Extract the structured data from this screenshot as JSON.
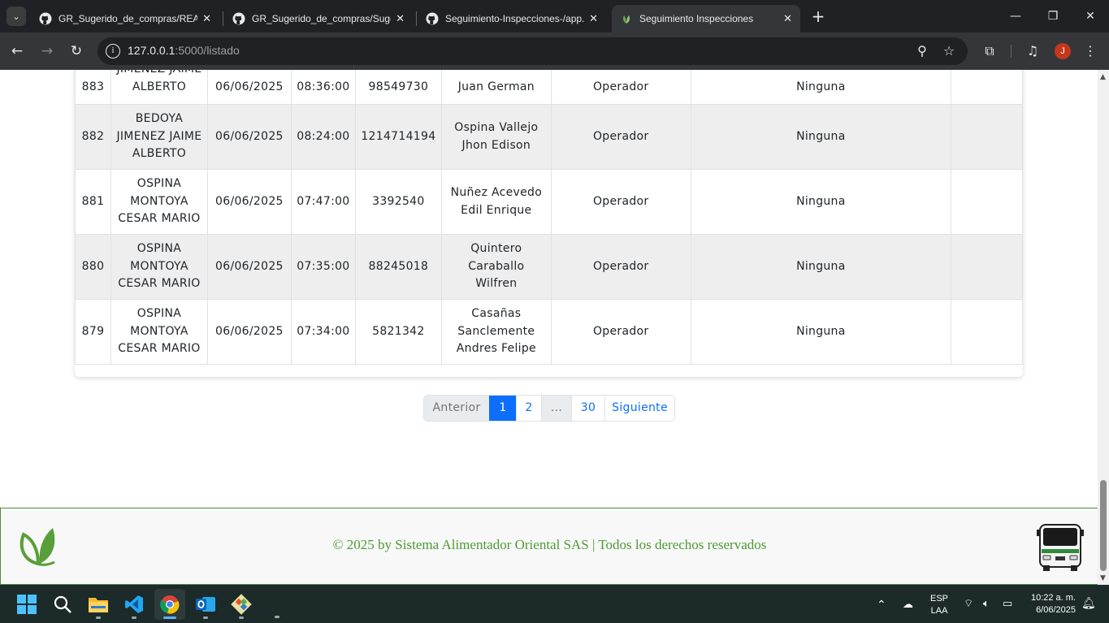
{
  "browser": {
    "tabs": [
      {
        "title": "GR_Sugerido_de_compras/README",
        "icon": "github-icon"
      },
      {
        "title": "GR_Sugerido_de_compras/Sugerido",
        "icon": "github-icon"
      },
      {
        "title": "Seguimiento-Inspecciones-/app.py",
        "icon": "github-icon"
      },
      {
        "title": "Seguimiento Inspecciones",
        "icon": "leaf-icon",
        "active": true
      }
    ],
    "url_host": "127.0.0.1",
    "url_path": ":5000/listado",
    "avatar_letter": "J"
  },
  "table": {
    "rows": [
      {
        "id": "883",
        "inspector": "JIMENEZ JAIME ALBERTO",
        "fecha": "06/06/2025",
        "hora": "08:36:00",
        "cedula": "98549730",
        "nombre": "Juan German",
        "cargo": "Operador",
        "novedad": "Ninguna",
        "extra": ""
      },
      {
        "id": "882",
        "inspector": "BEDOYA JIMENEZ JAIME ALBERTO",
        "fecha": "06/06/2025",
        "hora": "08:24:00",
        "cedula": "1214714194",
        "nombre": "Ospina Vallejo Jhon Edison",
        "cargo": "Operador",
        "novedad": "Ninguna",
        "extra": ""
      },
      {
        "id": "881",
        "inspector": "OSPINA MONTOYA CESAR MARIO",
        "fecha": "06/06/2025",
        "hora": "07:47:00",
        "cedula": "3392540",
        "nombre": "Nuñez Acevedo Edil Enrique",
        "cargo": "Operador",
        "novedad": "Ninguna",
        "extra": ""
      },
      {
        "id": "880",
        "inspector": "OSPINA MONTOYA CESAR MARIO",
        "fecha": "06/06/2025",
        "hora": "07:35:00",
        "cedula": "88245018",
        "nombre": "Quintero Caraballo Wilfren",
        "cargo": "Operador",
        "novedad": "Ninguna",
        "extra": ""
      },
      {
        "id": "879",
        "inspector": "OSPINA MONTOYA CESAR MARIO",
        "fecha": "06/06/2025",
        "hora": "07:34:00",
        "cedula": "5821342",
        "nombre": "Casañas Sanclemente Andres Felipe",
        "cargo": "Operador",
        "novedad": "Ninguna",
        "extra": ""
      }
    ]
  },
  "pagination": {
    "prev": "Anterior",
    "pages": [
      "1",
      "2",
      "...",
      "30"
    ],
    "active": "1",
    "next": "Siguiente"
  },
  "footer": {
    "text": "© 2025 by Sistema Alimentador Oriental SAS | Todos los derechos reservados"
  },
  "taskbar": {
    "apps": [
      "windows-start-icon",
      "search-icon",
      "file-explorer-icon",
      "vscode-icon",
      "chrome-icon",
      "outlook-icon",
      "git-icon"
    ],
    "lang_1": "ESP",
    "lang_2": "LAA",
    "time": "10:22 a. m.",
    "date": "6/06/2025"
  },
  "colors": {
    "accent": "#0d6efd",
    "brand_green": "#4e9a35",
    "stripe": "#eeeeee"
  }
}
